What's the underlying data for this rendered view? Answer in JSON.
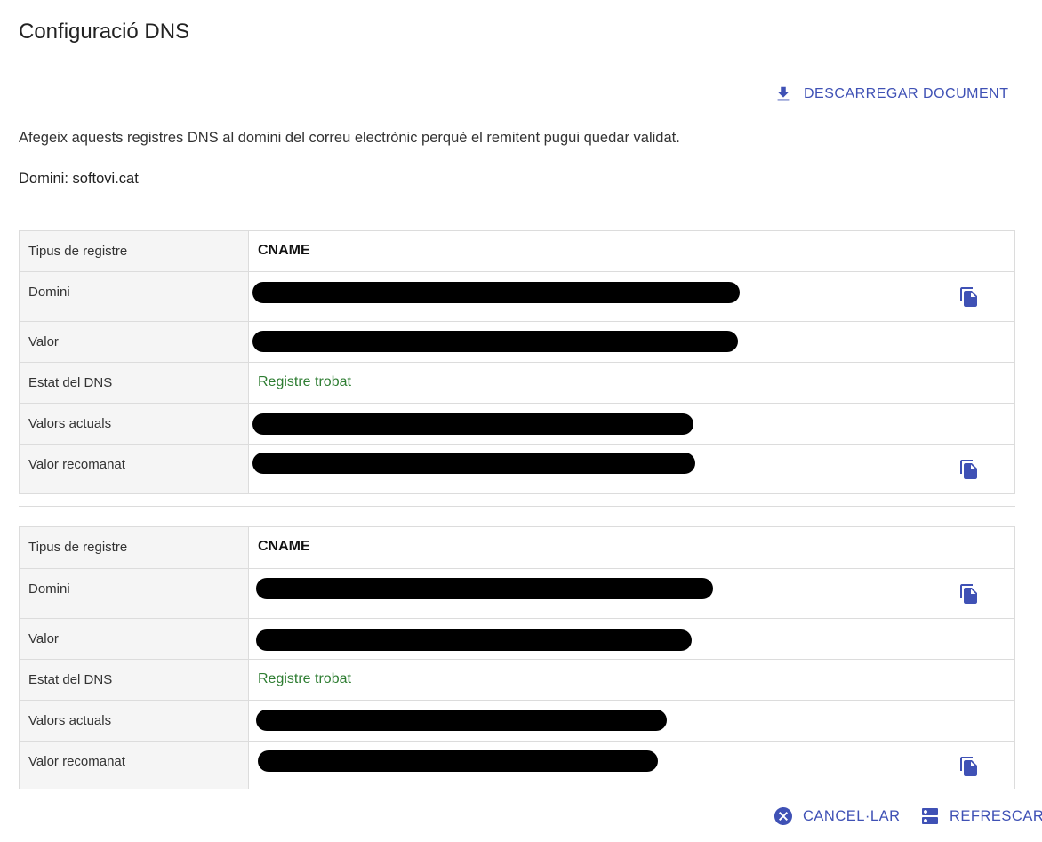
{
  "title": "Configuració DNS",
  "download_label": "DESCARREGAR DOCUMENT",
  "description": "Afegeix aquests registres DNS al domini del correu electrònic perquè el remitent pugui quedar validat.",
  "domain_line": "Domini: softovi.cat",
  "records": [
    {
      "labels": {
        "type": "Tipus de registre",
        "domain": "Domini",
        "value": "Valor",
        "status": "Estat del DNS",
        "current": "Valors actuals",
        "recommended": "Valor recomanat"
      },
      "type": "CNAME",
      "status": "Registre trobat"
    },
    {
      "labels": {
        "type": "Tipus de registre",
        "domain": "Domini",
        "value": "Valor",
        "status": "Estat del DNS",
        "current": "Valors actuals",
        "recommended": "Valor recomanat"
      },
      "type": "CNAME",
      "status": "Registre trobat"
    }
  ],
  "footer": {
    "cancel_label": "CANCEL·LAR",
    "refresh_label": "REFRESCAR"
  },
  "colors": {
    "accent": "#3f51b5",
    "success": "#2e7d32"
  },
  "icons": {
    "download": "download-icon",
    "copy": "copy-icon",
    "cancel": "cancel-circle-icon",
    "refresh": "dns-server-icon"
  }
}
